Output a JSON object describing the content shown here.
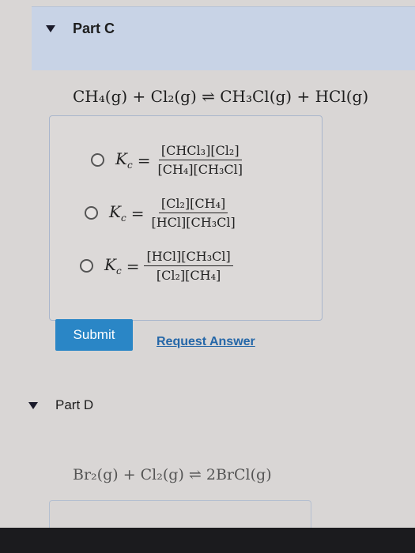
{
  "part_c": {
    "label": "Part C",
    "equation": "CH₄(g) + Cl₂(g) ⇌ CH₃Cl(g) + HCl(g)",
    "options": [
      {
        "k": "K",
        "k_sub": "c",
        "equals": "=",
        "numerator": "[CHCl₃][Cl₂]",
        "denominator": "[CH₄][CH₃Cl]"
      },
      {
        "k": "K",
        "k_sub": "c",
        "equals": "=",
        "numerator": "[Cl₂][CH₄]",
        "denominator": "[HCl][CH₃Cl]"
      },
      {
        "k": "K",
        "k_sub": "c",
        "equals": "=",
        "numerator": "[HCl][CH₃Cl]",
        "denominator": "[Cl₂][CH₄]"
      }
    ],
    "submit_label": "Submit",
    "request_answer_label": "Request Answer"
  },
  "part_d": {
    "label": "Part D",
    "equation": "Br₂(g) + Cl₂(g) ⇌ 2BrCl(g)"
  },
  "colors": {
    "header_bg": "#c8d3e6",
    "submit_bg": "#2a86c6",
    "link": "#2567a8"
  }
}
